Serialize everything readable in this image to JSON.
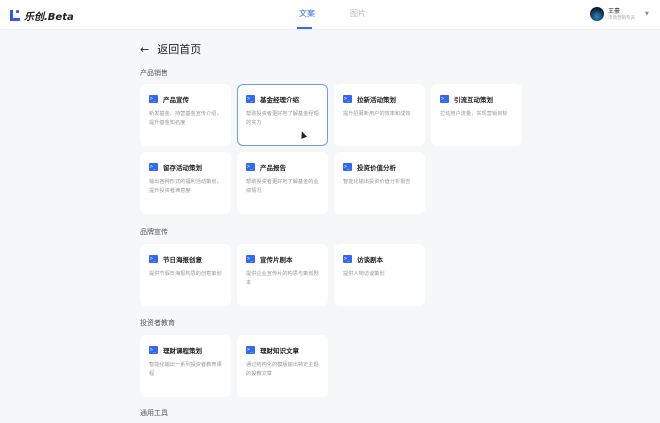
{
  "header": {
    "logo": "乐创.Beta",
    "tabs": [
      "文案",
      "图片"
    ],
    "user": {
      "name": "王豪",
      "role": "市场营销专员"
    }
  },
  "back": {
    "title": "返回首页"
  },
  "sections": [
    {
      "title": "产品销售",
      "cards": [
        {
          "title": "产品宣传",
          "desc": "新发基金、持营基金宣传介绍，提升基金知名度"
        },
        {
          "title": "基金经理介绍",
          "desc": "帮助投资者更好地了解基金经理的实力"
        },
        {
          "title": "拉新活动策划",
          "desc": "提升招募新用户的效率和成效"
        },
        {
          "title": "引流互动策划",
          "desc": "拉动用户流量，实现营销目标"
        },
        {
          "title": "留存活动策划",
          "desc": "输出各种形式的福利活动策划，提升投资者满意度"
        },
        {
          "title": "产品报告",
          "desc": "帮助投资者更好地了解基金的业绩情况"
        },
        {
          "title": "投资价值分析",
          "desc": "智能化输出投资价值分析报告"
        }
      ]
    },
    {
      "title": "品牌宣传",
      "cards": [
        {
          "title": "节日海报创意",
          "desc": "提供节假日海报构思的创意策划"
        },
        {
          "title": "宣传片剧本",
          "desc": "提供企业宣传片的构思与策划剧本"
        },
        {
          "title": "访谈剧本",
          "desc": "提供人物访谈策划"
        }
      ]
    },
    {
      "title": "投资者教育",
      "cards": [
        {
          "title": "理财课程策划",
          "desc": "智能化输出一系列投资者教育课程"
        },
        {
          "title": "理财知识文章",
          "desc": "通过结构化的模版输出特定主题的投教文章"
        }
      ]
    },
    {
      "title": "通用工具",
      "cards": []
    }
  ]
}
